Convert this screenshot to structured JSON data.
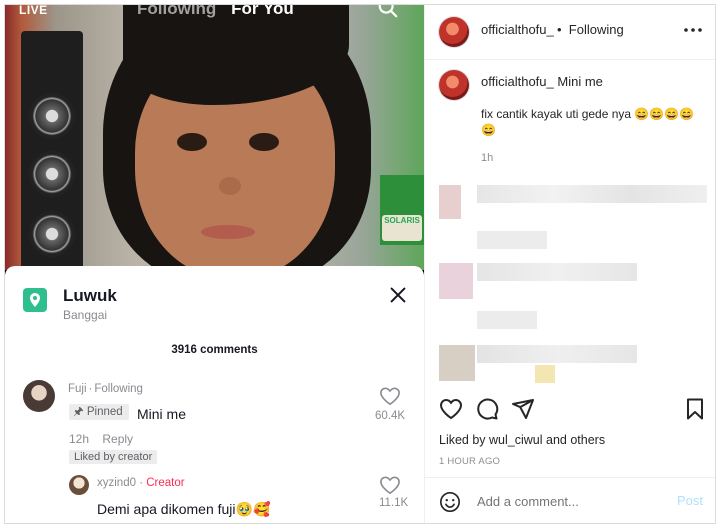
{
  "tiktok": {
    "top": {
      "live": "LIVE",
      "tab_following": "Following",
      "tab_foryou": "For You"
    },
    "sign_text": "SOLARIS",
    "location": {
      "title": "Luwuk",
      "subtitle": "Banggai"
    },
    "comments_count": "3916 comments",
    "comment": {
      "user": "Fuji",
      "following": "Following",
      "pinned": "Pinned",
      "text": "Mini me",
      "time": "12h",
      "reply": "Reply",
      "liked_by_creator": "Liked by creator",
      "likes": "60.4K"
    },
    "reply_comment": {
      "user": "xyzind0",
      "badge": "Creator",
      "text": "Demi apa dikomen fuji🥹🥰",
      "likes": "11.1K"
    }
  },
  "instagram": {
    "username": "officialthofu_",
    "follow_status": "Following",
    "caption_user": "officialthofu_",
    "caption_title": "Mini me",
    "caption_text": "fix cantik kayak uti gede nya 😄😄😄😄😄",
    "caption_time": "1h",
    "liked_by": "Liked by wul_ciwul and others",
    "time_ago": "1 HOUR AGO",
    "add_comment_placeholder": "Add a comment...",
    "post_label": "Post"
  }
}
